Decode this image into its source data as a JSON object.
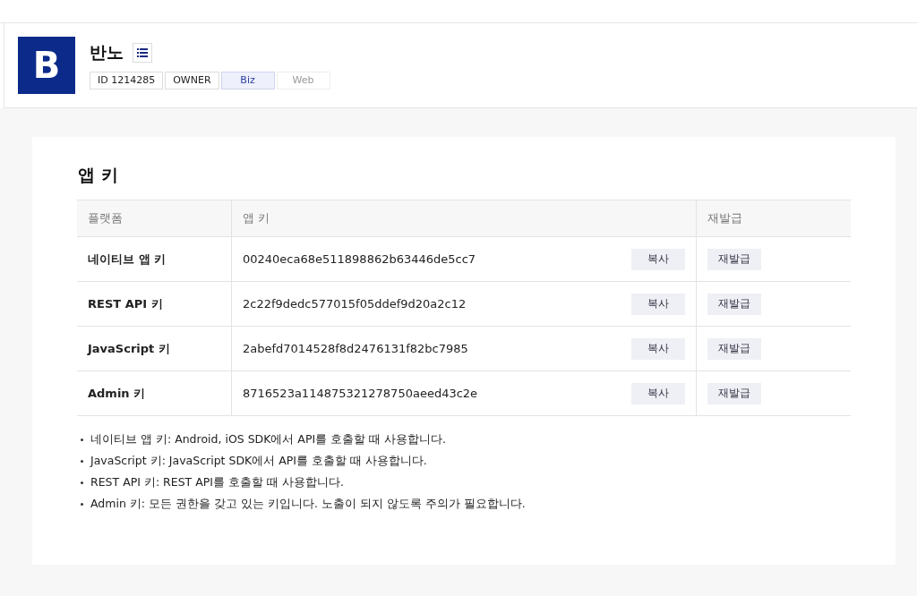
{
  "app": {
    "logo_letter": "B",
    "name": "반노",
    "tags": [
      {
        "label": "ID 1214285",
        "kind": "plain"
      },
      {
        "label": "OWNER",
        "kind": "plain"
      },
      {
        "label": "Biz",
        "kind": "active"
      },
      {
        "label": "Web",
        "kind": "inactive"
      }
    ]
  },
  "section_title": "앱 키",
  "table": {
    "columns": [
      "플랫폼",
      "앱 키",
      "재발급"
    ],
    "rows": [
      {
        "platform": "네이티브 앱 키",
        "key": "00240eca68e511898862b63446de5cc7",
        "copy": "복사",
        "reissue": "재발급"
      },
      {
        "platform": "REST API 키",
        "key": "2c22f9dedc577015f05ddef9d20a2c12",
        "copy": "복사",
        "reissue": "재발급"
      },
      {
        "platform": "JavaScript 키",
        "key": "2abefd7014528f8d2476131f82bc7985",
        "copy": "복사",
        "reissue": "재발급"
      },
      {
        "platform": "Admin 키",
        "key": "8716523a114875321278750aeed43c2e",
        "copy": "복사",
        "reissue": "재발급"
      }
    ]
  },
  "notes": [
    "네이티브 앱 키: Android, iOS SDK에서 API를 호출할 때 사용합니다.",
    "JavaScript 키: JavaScript SDK에서 API를 호출할 때 사용합니다.",
    "REST API 키: REST API를 호출할 때 사용합니다.",
    "Admin 키: 모든 권한을 갖고 있는 키입니다. 노출이 되지 않도록 주의가 필요합니다."
  ]
}
